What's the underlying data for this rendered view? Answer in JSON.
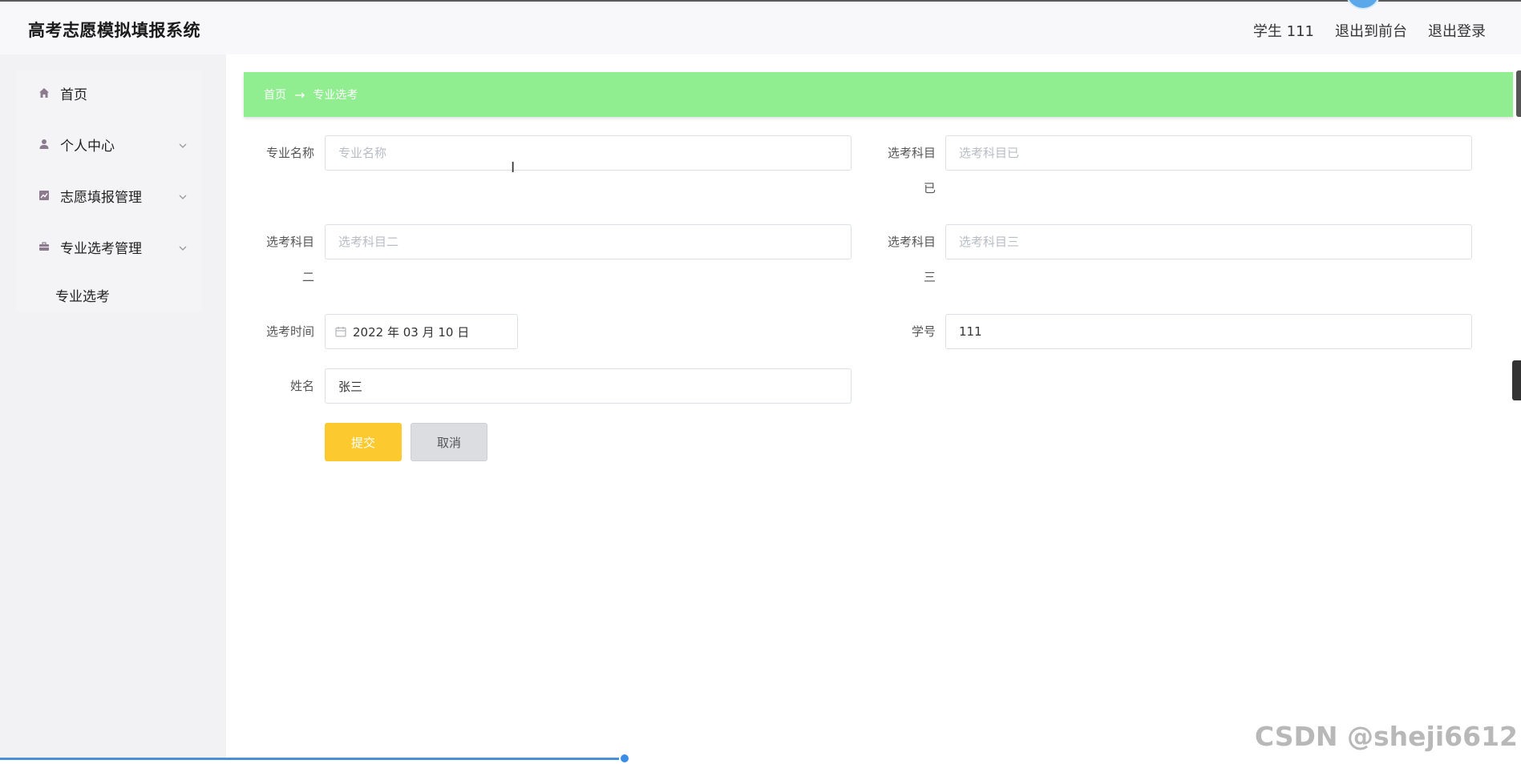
{
  "app": {
    "title": "高考志愿模拟填报系统"
  },
  "header": {
    "user_label": "学生 111",
    "back_front_label": "退出到前台",
    "logout_label": "退出登录"
  },
  "sidebar": {
    "items": [
      {
        "label": "首页",
        "icon": "home-icon"
      },
      {
        "label": "个人中心",
        "icon": "user-icon"
      },
      {
        "label": "志愿填报管理",
        "icon": "chart-icon"
      },
      {
        "label": "专业选考管理",
        "icon": "briefcase-icon"
      }
    ],
    "sub_item": "专业选考"
  },
  "breadcrumb": {
    "home": "首页",
    "separator": "→",
    "current": "专业选考"
  },
  "form": {
    "major_name": {
      "label": "专业名称",
      "placeholder": "专业名称",
      "value": ""
    },
    "subject_1": {
      "label_line1": "选考科目",
      "label_line2": "已",
      "placeholder": "选考科目已",
      "value": ""
    },
    "subject_2": {
      "label_line1": "选考科目",
      "label_line2": "二",
      "placeholder": "选考科目二",
      "value": ""
    },
    "subject_3": {
      "label_line1": "选考科目",
      "label_line2": "三",
      "placeholder": "选考科目三",
      "value": ""
    },
    "exam_time": {
      "label": "选考时间",
      "value": "2022 年 03 月 10 日"
    },
    "student_id": {
      "label": "学号",
      "value": "111"
    },
    "name": {
      "label": "姓名",
      "value": "张三"
    },
    "submit_label": "提交",
    "cancel_label": "取消"
  },
  "colors": {
    "breadcrumb_bg": "#90ee90",
    "submit_bg": "#fcca2f",
    "cancel_bg": "#dcdde1"
  },
  "watermark": "CSDN @sheji6612"
}
